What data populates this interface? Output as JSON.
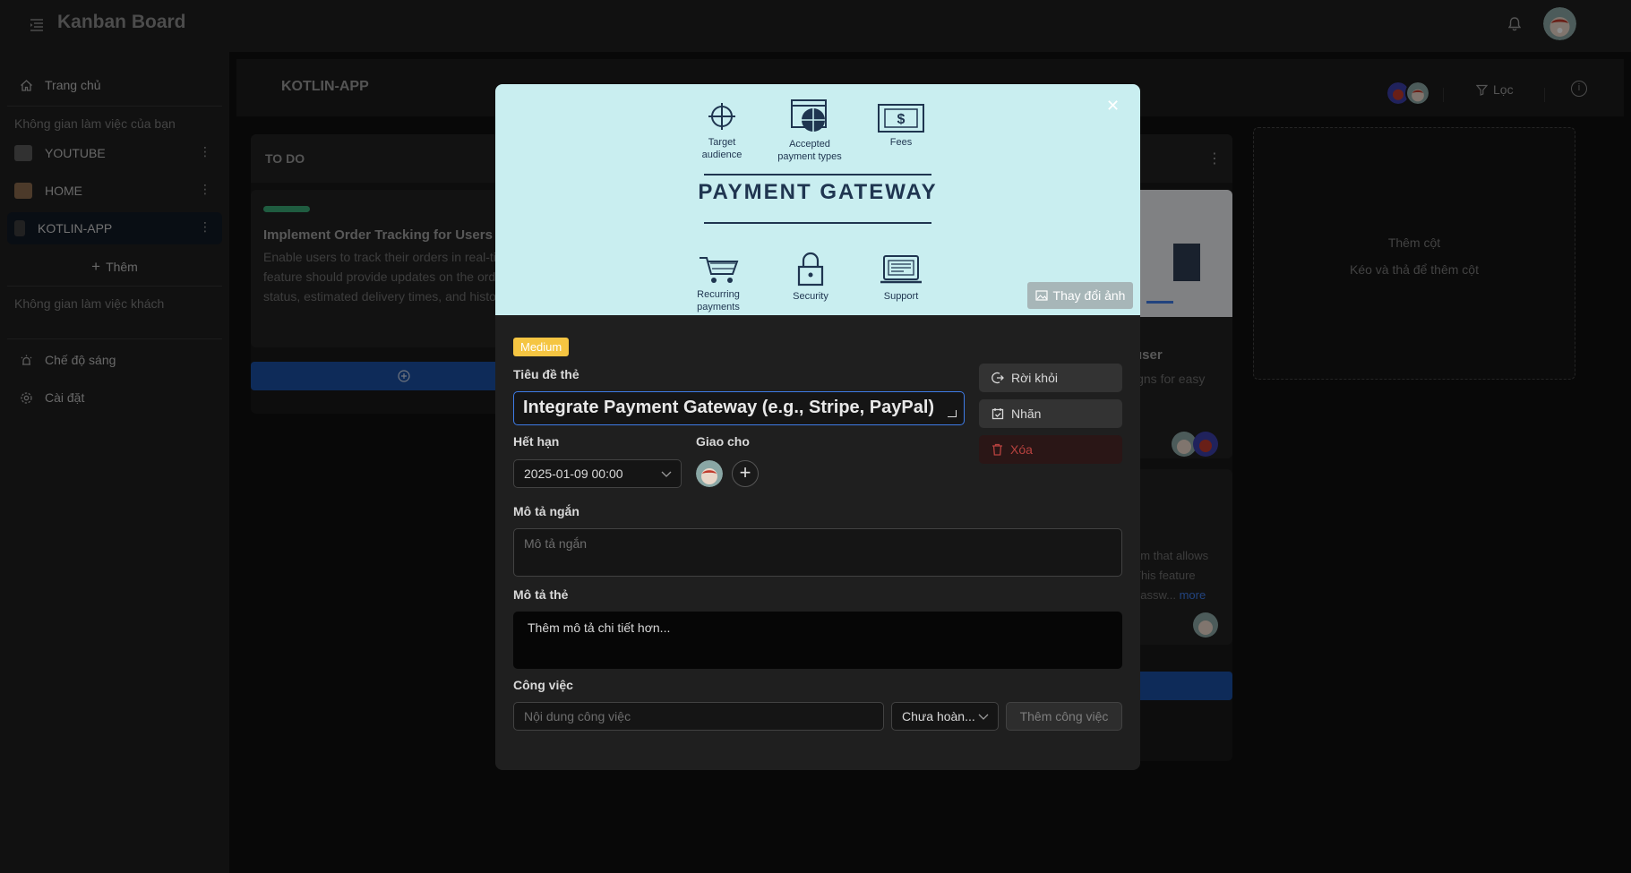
{
  "app": {
    "title": "Kanban Board"
  },
  "sidebar": {
    "home": "Trang chủ",
    "your_workspaces_label": "Không gian làm việc của bạn",
    "workspaces": [
      {
        "label": "YOUTUBE"
      },
      {
        "label": "HOME"
      },
      {
        "label": "KOTLIN-APP"
      }
    ],
    "add_label": "Thêm",
    "guest_workspaces_label": "Không gian làm việc khách",
    "light_mode": "Chế độ sáng",
    "settings": "Cài đặt"
  },
  "board": {
    "title": "KOTLIN-APP",
    "filter_label": "Lọc",
    "columns": [
      {
        "title": "TO DO",
        "card": {
          "title": "Implement Order Tracking for Users",
          "lines": [
            "Enable users to track their orders in real-ti",
            "feature should provide updates on the ord",
            "status, estimated delivery times, and histo"
          ]
        }
      }
    ],
    "right_card_1": {
      "title_fragment": "user",
      "text_fragment": "igns for easy"
    },
    "right_card_2": {
      "lines": [
        "em that allows",
        "This feature",
        "passw..."
      ],
      "more_link": "more"
    },
    "add_column": {
      "title": "Thêm cột",
      "hint": "Kéo và thả để thêm cột"
    }
  },
  "modal": {
    "cover": {
      "heading": "PAYMENT GATEWAY",
      "items": [
        {
          "label": "Target audience",
          "icon": "target-icon"
        },
        {
          "label": "Accepted payment types",
          "icon": "globe-icon"
        },
        {
          "label": "Fees",
          "icon": "dollar-icon"
        },
        {
          "label": "Recurring payments",
          "icon": "cart-icon"
        },
        {
          "label": "Security",
          "icon": "lock-icon"
        },
        {
          "label": "Support",
          "icon": "laptop-icon"
        }
      ],
      "change_image_label": "Thay đổi ảnh"
    },
    "priority_badge": "Medium",
    "title_label": "Tiêu đề thẻ",
    "title_value": "Integrate Payment Gateway (e.g., Stripe, PayPal)",
    "due_label": "Hết hạn",
    "due_value": "2025-01-09 00:00",
    "assign_label": "Giao cho",
    "short_desc_label": "Mô tả ngắn",
    "short_desc_placeholder": "Mô tả ngắn",
    "desc_label": "Mô tả thẻ",
    "desc_placeholder": "Thêm mô tả chi tiết hơn...",
    "tasks_label": "Công việc",
    "task_input_placeholder": "Nội dung công việc",
    "task_status_value": "Chưa hoàn...",
    "add_task_button": "Thêm công việc",
    "actions": {
      "leave": "Rời khỏi",
      "labels": "Nhãn",
      "delete": "Xóa"
    }
  },
  "colors": {
    "accent": "#3e7be6",
    "badge": "#f5c542",
    "danger": "#b8423f",
    "cover_bg": "#c9eef0",
    "cover_ink": "#1f3550"
  }
}
